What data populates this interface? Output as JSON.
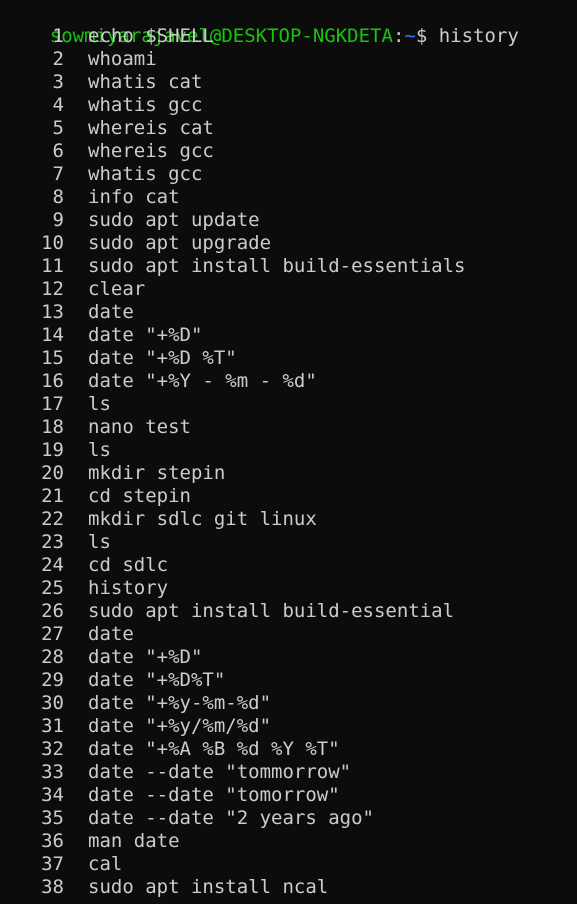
{
  "window": {
    "cutoff_text": "· · ·"
  },
  "prompt": {
    "user_host": "sowmiyarajavel@DESKTOP-NGKDETA",
    "separator": ":",
    "path": "~",
    "dollar": "$ ",
    "command": "history"
  },
  "history": [
    {
      "num": "1",
      "cmd": "echo $SHELL"
    },
    {
      "num": "2",
      "cmd": "whoami"
    },
    {
      "num": "3",
      "cmd": "whatis cat"
    },
    {
      "num": "4",
      "cmd": "whatis gcc"
    },
    {
      "num": "5",
      "cmd": "whereis cat"
    },
    {
      "num": "6",
      "cmd": "whereis gcc"
    },
    {
      "num": "7",
      "cmd": "whatis gcc"
    },
    {
      "num": "8",
      "cmd": "info cat"
    },
    {
      "num": "9",
      "cmd": "sudo apt update"
    },
    {
      "num": "10",
      "cmd": "sudo apt upgrade"
    },
    {
      "num": "11",
      "cmd": "sudo apt install build-essentials"
    },
    {
      "num": "12",
      "cmd": "clear"
    },
    {
      "num": "13",
      "cmd": "date"
    },
    {
      "num": "14",
      "cmd": "date \"+%D\""
    },
    {
      "num": "15",
      "cmd": "date \"+%D %T\""
    },
    {
      "num": "16",
      "cmd": "date \"+%Y - %m - %d\""
    },
    {
      "num": "17",
      "cmd": "ls"
    },
    {
      "num": "18",
      "cmd": "nano test"
    },
    {
      "num": "19",
      "cmd": "ls"
    },
    {
      "num": "20",
      "cmd": "mkdir stepin"
    },
    {
      "num": "21",
      "cmd": "cd stepin"
    },
    {
      "num": "22",
      "cmd": "mkdir sdlc git linux"
    },
    {
      "num": "23",
      "cmd": "ls"
    },
    {
      "num": "24",
      "cmd": "cd sdlc"
    },
    {
      "num": "25",
      "cmd": "history"
    },
    {
      "num": "26",
      "cmd": "sudo apt install build-essential"
    },
    {
      "num": "27",
      "cmd": "date"
    },
    {
      "num": "28",
      "cmd": "date \"+%D\""
    },
    {
      "num": "29",
      "cmd": "date \"+%D%T\""
    },
    {
      "num": "30",
      "cmd": "date \"+%y-%m-%d\""
    },
    {
      "num": "31",
      "cmd": "date \"+%y/%m/%d\""
    },
    {
      "num": "32",
      "cmd": "date \"+%A %B %d %Y %T\""
    },
    {
      "num": "33",
      "cmd": "date --date \"tommorrow\""
    },
    {
      "num": "34",
      "cmd": "date --date \"tomorrow\""
    },
    {
      "num": "35",
      "cmd": "date --date \"2 years ago\""
    },
    {
      "num": "36",
      "cmd": "man date"
    },
    {
      "num": "37",
      "cmd": "cal"
    },
    {
      "num": "38",
      "cmd": "sudo apt install ncal"
    }
  ],
  "colors": {
    "background": "#0c0c0c",
    "text": "#cccccc",
    "user_host": "#16c60c",
    "path": "#3b78ff"
  }
}
